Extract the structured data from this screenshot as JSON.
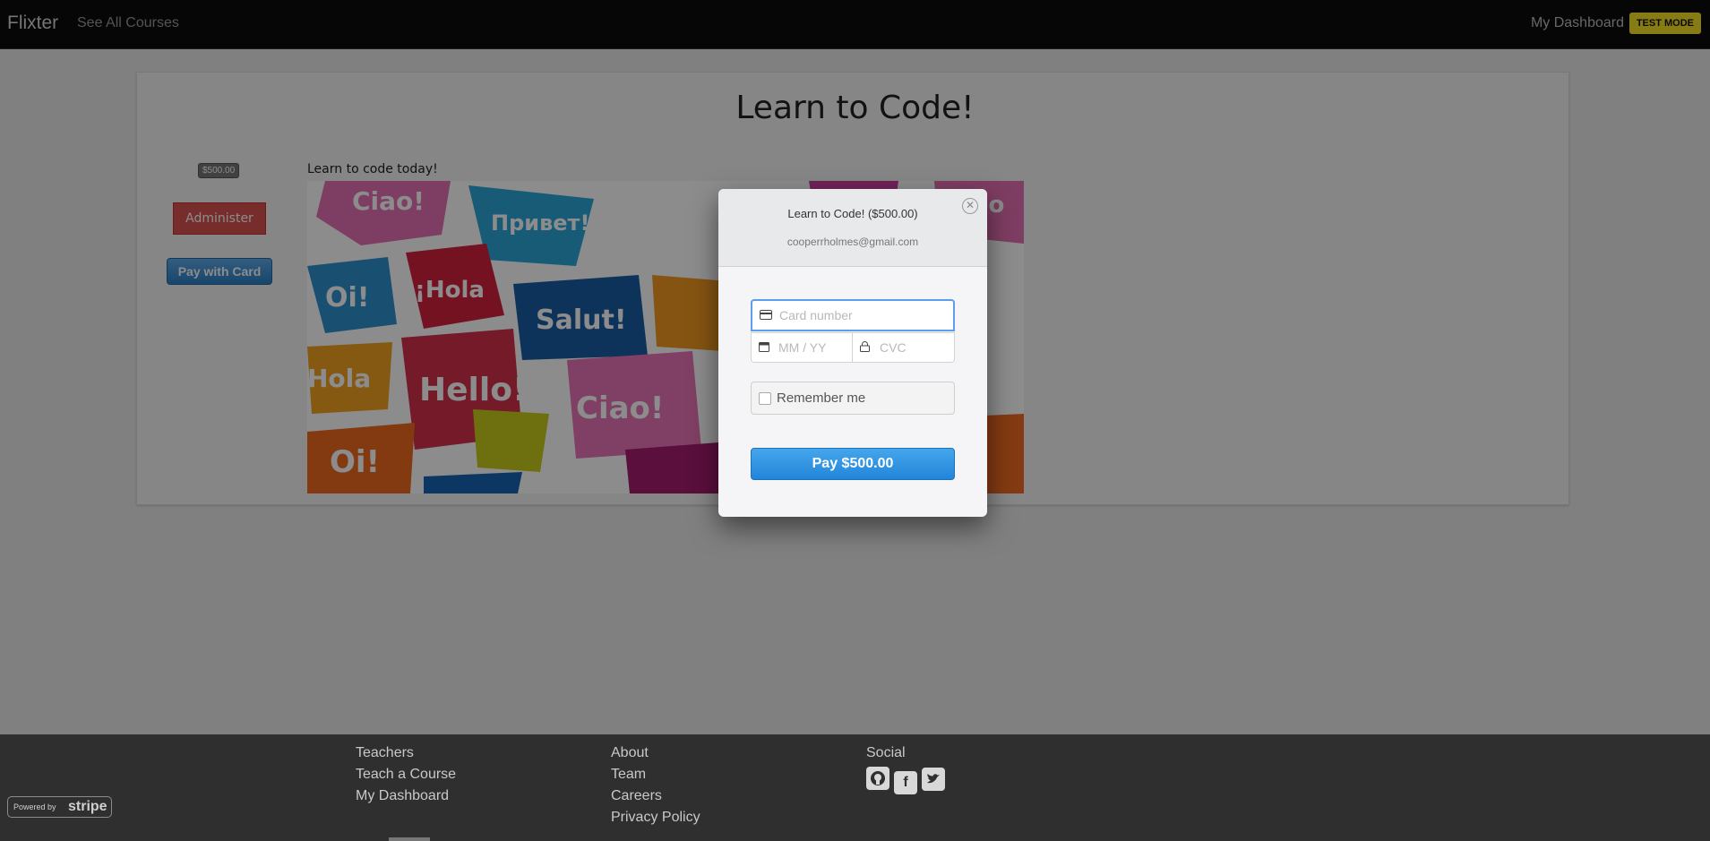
{
  "navbar": {
    "brand": "Flixter",
    "see_all_courses": "See All Courses",
    "my_dashboard": "My Dashboard",
    "test_mode": "TEST MODE"
  },
  "course": {
    "title": "Learn to Code!",
    "price": "$500.00",
    "administer_label": "Administer",
    "pay_with_card_label": "Pay with Card",
    "description": "Learn to code today!",
    "image_bubbles": [
      "Ciao!",
      "Привет!",
      "Oi!",
      "¡Hola",
      "Salut!",
      "Hello!",
      "Ciao!",
      "Oi!",
      "Hola",
      "Ciao"
    ]
  },
  "modal": {
    "title": "Learn to Code! ($500.00)",
    "email": "cooperrholmes@gmail.com",
    "card_number_placeholder": "Card number",
    "expiry_placeholder": "MM / YY",
    "cvc_placeholder": "CVC",
    "remember_me": "Remember me",
    "pay_label": "Pay $500.00"
  },
  "footer": {
    "col1": [
      "Teachers",
      "Teach a Course",
      "My Dashboard"
    ],
    "col2": [
      "About",
      "Team",
      "Careers",
      "Privacy Policy"
    ],
    "social_heading": "Social",
    "social_icons": [
      "github-icon",
      "facebook-icon",
      "twitter-icon"
    ],
    "stripe_badge_small": "Powered by",
    "stripe_badge_big": "stripe"
  },
  "colors": {
    "navbar_bg": "#0b0b0b",
    "test_mode_bg": "#f4e223",
    "administer_bg": "#d9534f",
    "pay_blue": "#2385d8",
    "footer_bg": "#2f2f2f"
  }
}
